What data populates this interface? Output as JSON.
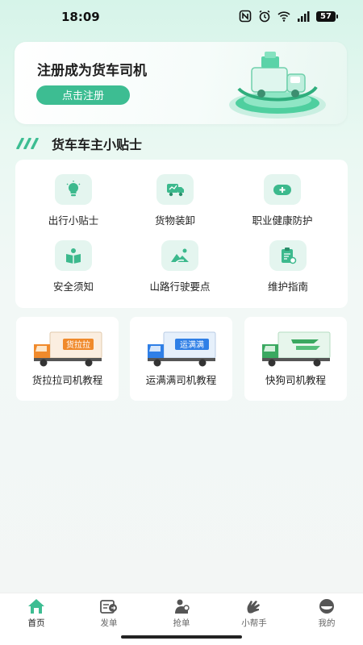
{
  "status_bar": {
    "time": "18:09",
    "battery": "57"
  },
  "banner": {
    "title": "注册成为货车司机",
    "button_label": "点击注册"
  },
  "section": {
    "title": "货车车主小贴士"
  },
  "tips": [
    {
      "label": "出行小贴士",
      "icon": "lightbulb-icon"
    },
    {
      "label": "货物装卸",
      "icon": "truck-loading-icon"
    },
    {
      "label": "职业健康防护",
      "icon": "medical-kit-icon"
    },
    {
      "label": "安全须知",
      "icon": "safety-book-icon"
    },
    {
      "label": "山路行驶要点",
      "icon": "mountain-road-icon"
    },
    {
      "label": "维护指南",
      "icon": "maintenance-clipboard-icon"
    }
  ],
  "tutorials": [
    {
      "label": "货拉拉司机教程",
      "truck_text": "货拉拉",
      "cab_color": "#f08a2c",
      "box_color": "#fbeee0"
    },
    {
      "label": "运满满司机教程",
      "truck_text": "运满满",
      "cab_color": "#2f7fe6",
      "box_color": "#e6f0fb"
    },
    {
      "label": "快狗司机教程",
      "truck_text": "",
      "cab_color": "#3aa860",
      "box_color": "#e7f6ec"
    }
  ],
  "nav": [
    {
      "label": "首页",
      "icon": "home-icon",
      "active": true
    },
    {
      "label": "发单",
      "icon": "send-order-icon",
      "active": false
    },
    {
      "label": "抢单",
      "icon": "grab-order-icon",
      "active": false
    },
    {
      "label": "小帮手",
      "icon": "helper-hand-icon",
      "active": false
    },
    {
      "label": "我的",
      "icon": "profile-icon",
      "active": false
    }
  ],
  "colors": {
    "accent": "#3dbd92",
    "tip_bg": "#e4f5ef",
    "icon_green": "#3cb98d"
  }
}
